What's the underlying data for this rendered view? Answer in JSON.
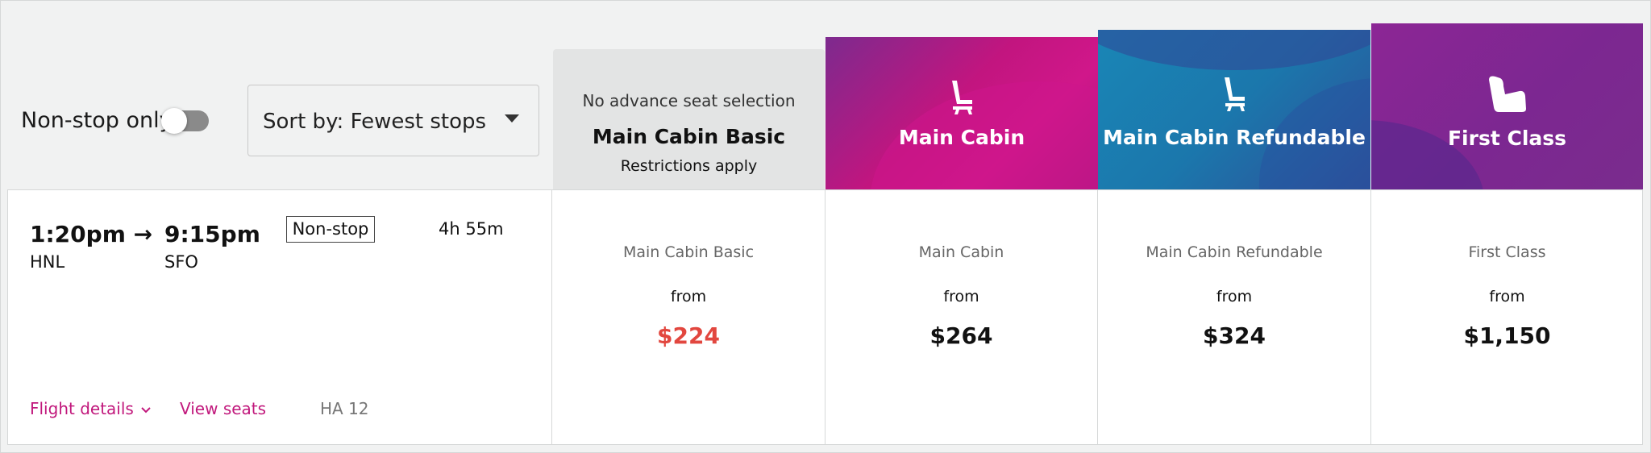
{
  "filters": {
    "nonstop_label": "Non-stop only",
    "nonstop_on": false,
    "sort_label": "Sort by: Fewest stops"
  },
  "cabins": [
    {
      "sub": "No advance seat selection",
      "title": "Main Cabin Basic",
      "note": "Restrictions apply"
    },
    {
      "title": "Main Cabin",
      "icon": "seat-icon"
    },
    {
      "title": "Main Cabin Refundable",
      "icon": "seat-icon"
    },
    {
      "title": "First Class",
      "icon": "first-class-seat-icon"
    }
  ],
  "flight": {
    "depart_time": "1:20pm",
    "arrow": "→",
    "arrive_time": "9:15pm",
    "origin": "HNL",
    "destination": "SFO",
    "stops": "Non-stop",
    "duration": "4h 55m",
    "details_label": "Flight details",
    "seats_label": "View seats",
    "flight_number": "HA 12"
  },
  "fares": [
    {
      "name": "Main Cabin Basic",
      "from": "from",
      "price": "$224",
      "color": "#e2473f"
    },
    {
      "name": "Main Cabin",
      "from": "from",
      "price": "$264",
      "color": "#111111"
    },
    {
      "name": "Main Cabin Refundable",
      "from": "from",
      "price": "$324",
      "color": "#111111"
    },
    {
      "name": "First Class",
      "from": "from",
      "price": "$1,150",
      "color": "#111111"
    }
  ],
  "colors": {
    "accent": "#c1187c",
    "lowest_price": "#e2473f"
  }
}
